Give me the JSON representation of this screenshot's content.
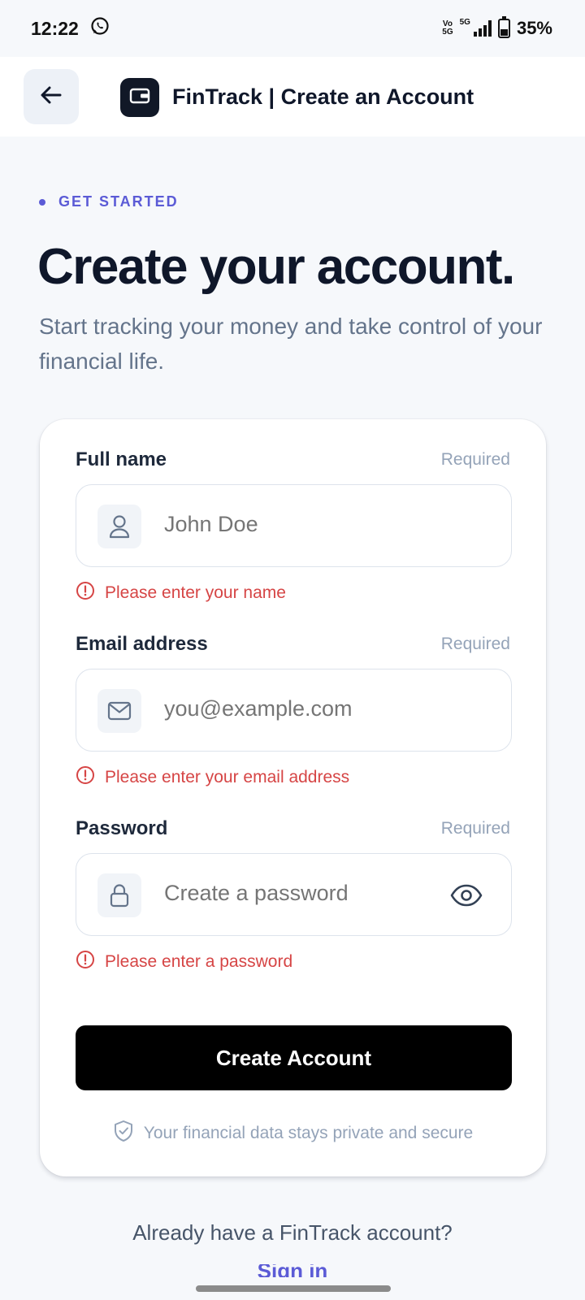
{
  "status_bar": {
    "time": "12:22",
    "volte_top": "Vo",
    "volte_bottom": "5G",
    "network": "5G",
    "battery": "35%"
  },
  "app_bar": {
    "title": "FinTrack | Create an Account",
    "back_icon": "arrow-left-icon",
    "logo_icon": "wallet-icon"
  },
  "hero": {
    "eyebrow": "GET STARTED",
    "headline": "Create your account.",
    "subtitle": "Start tracking your money and take control of your financial life."
  },
  "form": {
    "full_name": {
      "label": "Full name",
      "required": "Required",
      "placeholder": "John Doe",
      "icon": "user-icon",
      "error": "Please enter your name"
    },
    "email": {
      "label": "Email address",
      "required": "Required",
      "placeholder": "you@example.com",
      "icon": "mail-icon",
      "error": "Please enter your email address"
    },
    "password": {
      "label": "Password",
      "required": "Required",
      "placeholder": "Create a password",
      "icon": "lock-icon",
      "toggle_icon": "eye-icon",
      "error": "Please enter a password"
    },
    "submit_label": "Create Account",
    "secure_note": "Your financial data stays private and secure"
  },
  "footer": {
    "prompt": "Already have a FinTrack account?",
    "signin_label": "Sign in"
  },
  "colors": {
    "accent": "#5b5bd6",
    "error": "#d64545",
    "button": "#000000",
    "background": "#f6f8fb"
  }
}
